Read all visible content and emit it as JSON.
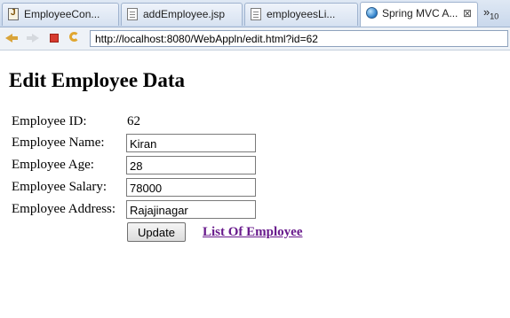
{
  "tabs": [
    {
      "label": "EmployeeCon...",
      "icon": "java-file-icon",
      "active": false
    },
    {
      "label": "addEmployee.jsp",
      "icon": "jsp-file-icon",
      "active": false
    },
    {
      "label": "employeesLi...",
      "icon": "jsp-file-icon",
      "active": false
    },
    {
      "label": "Spring MVC A...",
      "icon": "globe-icon",
      "active": true
    }
  ],
  "tab_close_glyph": "⊠",
  "tab_overflow": {
    "glyph": "»",
    "count": "10"
  },
  "nav": {
    "url": "http://localhost:8080/WebAppln/edit.html?id=62"
  },
  "page": {
    "title": "Edit Employee Data",
    "fields": {
      "id_label": "Employee ID:",
      "id_value": "62",
      "name_label": "Employee Name:",
      "name_value": "Kiran",
      "age_label": "Employee Age:",
      "age_value": "28",
      "salary_label": "Employee Salary:",
      "salary_value": "78000",
      "address_label": "Employee Address:",
      "address_value": "Rajajinagar"
    },
    "update_button": "Update",
    "list_link": "List Of Employee"
  },
  "colors": {
    "link_visited": "#681a8c",
    "tabbar_bg": "#c9d8ec",
    "stop_red": "#d63b2f"
  }
}
